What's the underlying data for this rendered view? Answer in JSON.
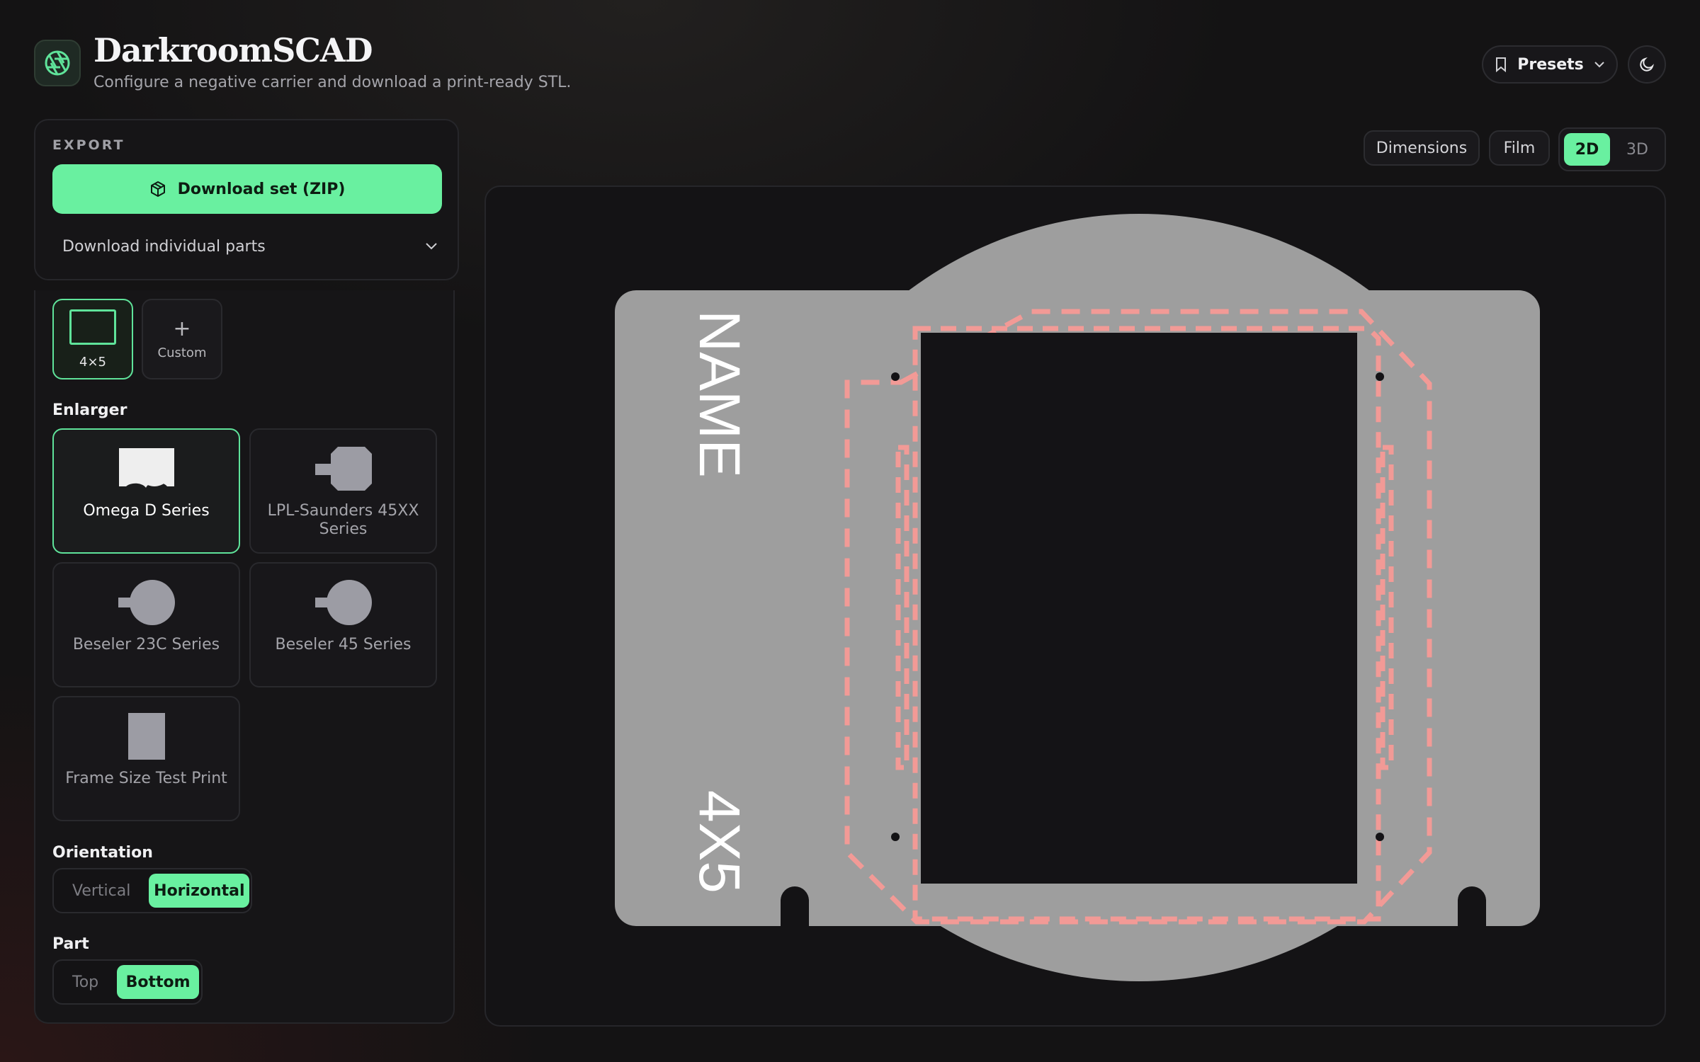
{
  "header": {
    "title": "DarkroomSCAD",
    "subtitle": "Configure a negative carrier and download a print-ready STL.",
    "presets_label": "Presets"
  },
  "export": {
    "section_label": "EXPORT",
    "download_zip_label": "Download set (ZIP)",
    "download_parts_label": "Download individual parts"
  },
  "film_format": {
    "options": [
      {
        "label": "4×5",
        "selected": true
      },
      {
        "label": "Custom",
        "selected": false
      }
    ]
  },
  "enlarger": {
    "label": "Enlarger",
    "options": [
      {
        "label": "Omega D Series",
        "selected": true
      },
      {
        "label": "LPL-Saunders 45XX Series",
        "selected": false
      },
      {
        "label": "Beseler 23C Series",
        "selected": false
      },
      {
        "label": "Beseler 45 Series",
        "selected": false
      },
      {
        "label": "Frame Size Test Print",
        "selected": false
      }
    ]
  },
  "orientation": {
    "label": "Orientation",
    "options": [
      "Vertical",
      "Horizontal"
    ],
    "selected": "Horizontal"
  },
  "part": {
    "label": "Part",
    "options": [
      "Top",
      "Bottom"
    ],
    "selected": "Bottom"
  },
  "view_controls": {
    "dimensions_label": "Dimensions",
    "film_label": "Film",
    "mode_2d": "2D",
    "mode_3d": "3D",
    "selected_mode": "2D"
  },
  "preview": {
    "carrier_name_text": "NAME",
    "carrier_format_text": "4X5"
  },
  "colors": {
    "accent": "#69f0a0",
    "carrier_fill": "#9e9e9e",
    "aperture_fill": "#141316",
    "outline_dash": "#f29a96"
  }
}
